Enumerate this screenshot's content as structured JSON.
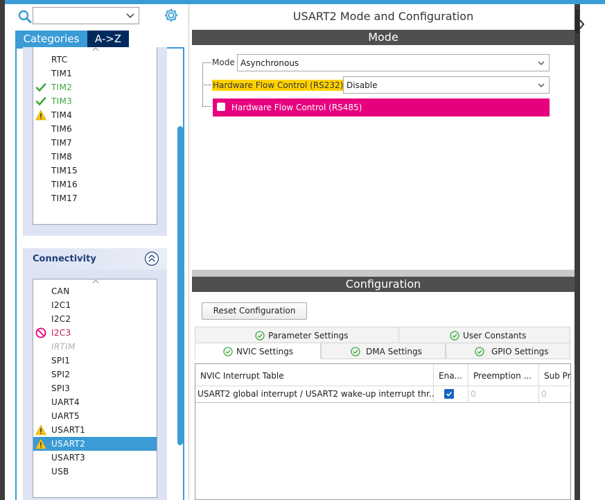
{
  "left": {
    "search": {
      "value": ""
    },
    "tabs": {
      "categories": "Categories",
      "az": "A->Z"
    },
    "timers": [
      {
        "label": "RTC",
        "status": "none"
      },
      {
        "label": "TIM1",
        "status": "none"
      },
      {
        "label": "TIM2",
        "status": "ok"
      },
      {
        "label": "TIM3",
        "status": "ok"
      },
      {
        "label": "TIM4",
        "status": "warning"
      },
      {
        "label": "TIM6",
        "status": "none"
      },
      {
        "label": "TIM7",
        "status": "none"
      },
      {
        "label": "TIM8",
        "status": "none"
      },
      {
        "label": "TIM15",
        "status": "none"
      },
      {
        "label": "TIM16",
        "status": "none"
      },
      {
        "label": "TIM17",
        "status": "none"
      }
    ],
    "connectivity": {
      "title": "Connectivity",
      "items": [
        {
          "label": "CAN",
          "status": "none"
        },
        {
          "label": "I2C1",
          "status": "none"
        },
        {
          "label": "I2C2",
          "status": "none"
        },
        {
          "label": "I2C3",
          "status": "blocked"
        },
        {
          "label": "IRTIM",
          "status": "disabled"
        },
        {
          "label": "SPI1",
          "status": "none"
        },
        {
          "label": "SPI2",
          "status": "none"
        },
        {
          "label": "SPI3",
          "status": "none"
        },
        {
          "label": "UART4",
          "status": "none"
        },
        {
          "label": "UART5",
          "status": "none"
        },
        {
          "label": "USART1",
          "status": "warning"
        },
        {
          "label": "USART2",
          "status": "warning",
          "selected": true
        },
        {
          "label": "USART3",
          "status": "none"
        },
        {
          "label": "USB",
          "status": "none"
        }
      ]
    }
  },
  "right": {
    "title": "USART2 Mode and Configuration",
    "mode_header": "Mode",
    "mode": {
      "label": "Mode",
      "value": "Asynchronous"
    },
    "flow232": {
      "label": "Hardware Flow Control (RS232)",
      "value": "Disable"
    },
    "flow485": {
      "label": "Hardware Flow Control (RS485)",
      "checked": false
    },
    "config_header": "Configuration",
    "reset_label": "Reset Configuration",
    "tabs_row1": [
      "Parameter Settings",
      "User Constants"
    ],
    "tabs_row2": [
      "NVIC Settings",
      "DMA Settings",
      "GPIO Settings"
    ],
    "active_tab": "NVIC Settings",
    "table": {
      "headers": [
        "NVIC Interrupt Table",
        "Ena...",
        "Preemption ...",
        "Sub Pr"
      ],
      "rows": [
        {
          "name": "USART2 global interrupt / USART2 wake-up interrupt thr...",
          "enabled": true,
          "preemption": "0",
          "sub": "0"
        }
      ]
    }
  },
  "colors": {
    "accent": "#3a9bd5",
    "ok": "#3aaa3a",
    "warning": "#f5c518",
    "blocked": "#e6007e",
    "highlight": "#ffd200"
  }
}
